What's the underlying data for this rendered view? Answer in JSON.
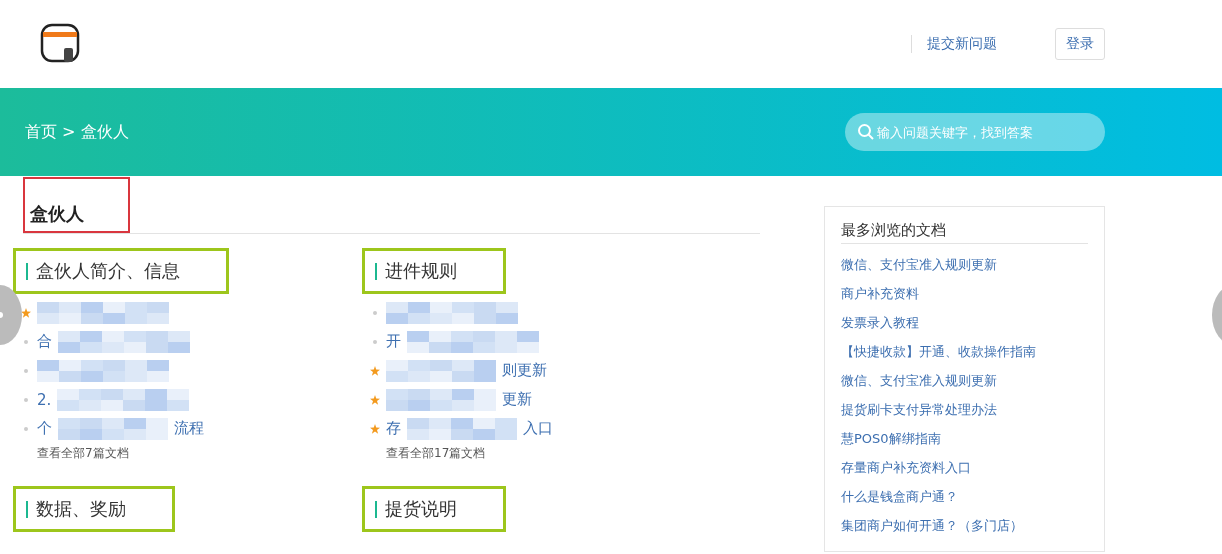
{
  "header": {
    "submit_link": "提交新问题",
    "login_button": "登录"
  },
  "banner": {
    "breadcrumb": "首页 > 盒伙人",
    "search": {
      "placeholder": "输入问题关键字，找到答案"
    }
  },
  "category": {
    "title": "盒伙人",
    "sections": [
      {
        "title": "盒伙人简介、信息",
        "items": [
          {
            "starred": true
          },
          {
            "starred": false,
            "start": "合"
          },
          {
            "starred": false
          },
          {
            "starred": false,
            "start": "2."
          },
          {
            "starred": false,
            "start": "个",
            "end": "流程"
          }
        ],
        "more": "查看全部7篇文档"
      },
      {
        "title": "进件规则",
        "items": [
          {
            "starred": false
          },
          {
            "starred": false,
            "start": "开"
          },
          {
            "starred": true,
            "end": "则更新"
          },
          {
            "starred": true,
            "end": "更新"
          },
          {
            "starred": true,
            "start": "存",
            "end": "入口"
          }
        ],
        "more": "查看全部17篇文档"
      },
      {
        "title": "数据、奖励"
      },
      {
        "title": "提货说明"
      }
    ]
  },
  "most_viewed": {
    "title": "最多浏览的文档",
    "links": [
      "微信、支付宝准入规则更新",
      "商户补充资料",
      "发票录入教程",
      "【快捷收款】开通、收款操作指南",
      "微信、支付宝准入规则更新",
      "提货刷卡支付异常处理办法",
      "慧POS0解绑指南",
      "存量商户补充资料入口",
      "什么是钱盒商户通？",
      "集团商户如何开通？（多门店）"
    ]
  }
}
